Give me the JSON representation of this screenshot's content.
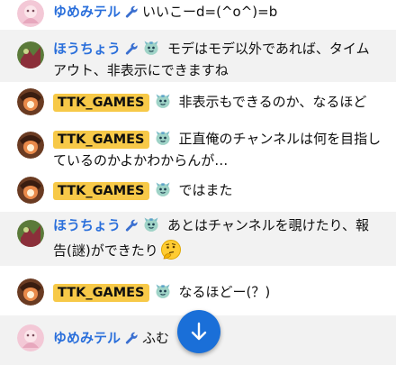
{
  "messages": [
    {
      "author": "ゆめみテル",
      "author_style": "blue",
      "text": "いいこーd=(^o^)=b",
      "continued": "",
      "avatar": "pink"
    },
    {
      "author": "ほうちょう",
      "author_style": "blue",
      "text": "モデはモデ以外であれば、タイム",
      "continued": "アウト、非表示にできますね",
      "avatar": "green"
    },
    {
      "author": "TTK_GAMES",
      "author_style": "badge",
      "text": "非表示もできるのか、なるほど",
      "continued": "",
      "avatar": "orange"
    },
    {
      "author": "TTK_GAMES",
      "author_style": "badge",
      "text": "正直俺のチャンネルは何を目指し",
      "continued": "ているのかよかわからんが…",
      "avatar": "orange"
    },
    {
      "author": "TTK_GAMES",
      "author_style": "badge",
      "text": "ではまた",
      "continued": "",
      "avatar": "orange"
    },
    {
      "author": "ほうちょう",
      "author_style": "blue",
      "text": "あとはチャンネルを覗けたり、報",
      "continued": "告(謎)ができたり",
      "avatar": "green"
    },
    {
      "author": "TTK_GAMES",
      "author_style": "badge",
      "text": "なるほどー(？)",
      "continued": "",
      "avatar": "orange"
    },
    {
      "author": "ゆめみテル",
      "author_style": "blue",
      "text": "ふむ",
      "continued": "",
      "avatar": "pink"
    }
  ],
  "icons": {
    "moderator": "wrench-icon",
    "member_badge": "mascot-icon",
    "thinking_emoji": "thinking-face-icon",
    "scroll_button": "arrow-down-icon"
  },
  "colors": {
    "author_blue": "#2a6fdb",
    "owner_badge": "#f7c948",
    "alt_row": "#f2f2f2",
    "fab": "#1a6fd8"
  }
}
